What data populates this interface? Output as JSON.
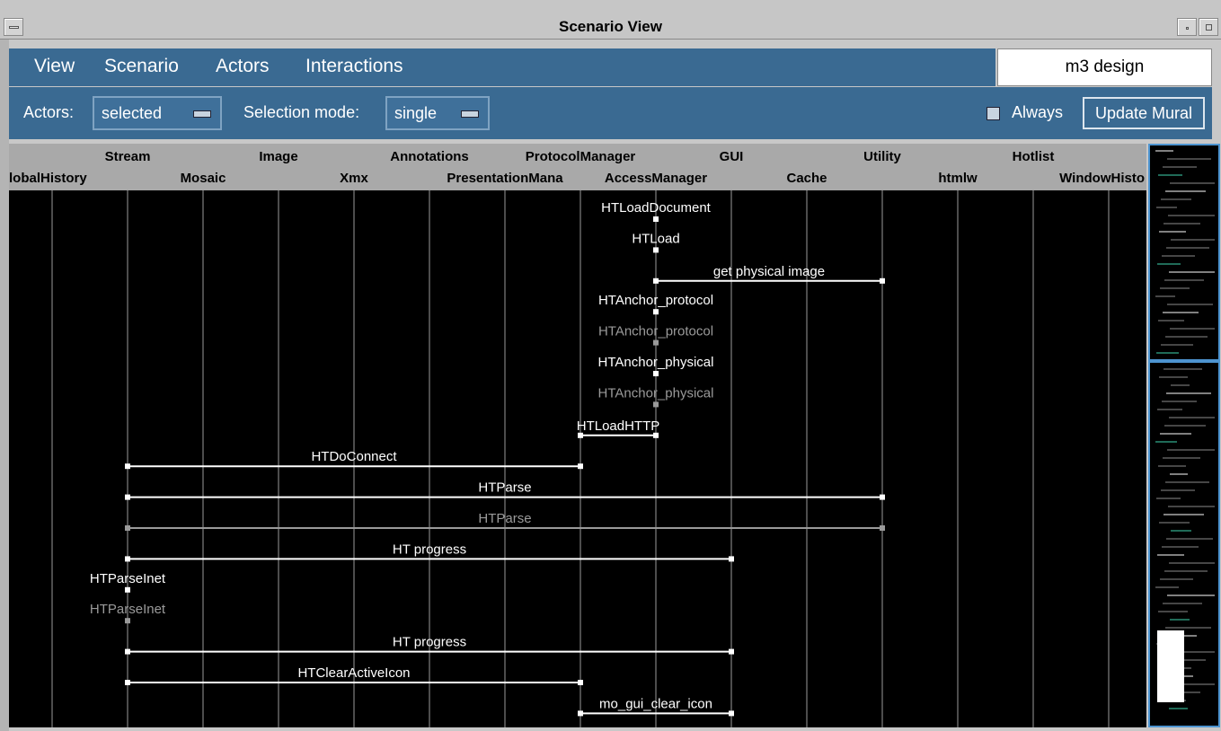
{
  "window": {
    "title": "Scenario View"
  },
  "menubar": {
    "items": [
      "View",
      "Scenario",
      "Actors",
      "Interactions"
    ]
  },
  "doc_name": "m3 design",
  "toolbar": {
    "actors_label": "Actors:",
    "actors_value": "selected",
    "mode_label": "Selection mode:",
    "mode_value": "single",
    "always_label": "Always",
    "update_label": "Update Mural"
  },
  "actors": {
    "row1": [
      "Stream",
      "Image",
      "Annotations",
      "ProtocolManager",
      "GUI",
      "Utility",
      "Hotlist"
    ],
    "row2": [
      "lobalHistory",
      "Mosaic",
      "Xmx",
      "PresentationMana",
      "AccessManager",
      "Cache",
      "htmlw",
      "WindowHisto"
    ]
  },
  "interactions": [
    {
      "label": "HTLoadDocument",
      "from": 8,
      "to": 8,
      "dim": false
    },
    {
      "label": "HTLoad",
      "from": 8,
      "to": 8,
      "dim": false
    },
    {
      "label": "get physical image",
      "from": 8,
      "to": 11,
      "dim": false
    },
    {
      "label": "HTAnchor_protocol",
      "from": 8,
      "to": 8,
      "dim": false
    },
    {
      "label": "HTAnchor_protocol",
      "from": 8,
      "to": 8,
      "dim": true
    },
    {
      "label": "HTAnchor_physical",
      "from": 8,
      "to": 8,
      "dim": false
    },
    {
      "label": "HTAnchor_physical",
      "from": 8,
      "to": 8,
      "dim": true
    },
    {
      "label": "HTLoadHTTP",
      "from": 8,
      "to": 7,
      "dim": false
    },
    {
      "label": "HTDoConnect",
      "from": 7,
      "to": 1,
      "dim": false
    },
    {
      "label": "HTParse",
      "from": 1,
      "to": 11,
      "dim": false
    },
    {
      "label": "HTParse",
      "from": 11,
      "to": 1,
      "dim": true
    },
    {
      "label": "HT progress",
      "from": 1,
      "to": 9,
      "dim": false
    },
    {
      "label": "HTParseInet",
      "from": 1,
      "to": 1,
      "dim": false
    },
    {
      "label": "HTParseInet",
      "from": 1,
      "to": 1,
      "dim": true
    },
    {
      "label": "HT progress",
      "from": 1,
      "to": 9,
      "dim": false
    },
    {
      "label": "HTClearActiveIcon",
      "from": 1,
      "to": 7,
      "dim": false
    },
    {
      "label": "mo_gui_clear_icon",
      "from": 7,
      "to": 9,
      "dim": false
    }
  ],
  "colors": {
    "panel": "#3a6a92",
    "diagram_bg": "#000000",
    "lifeline": "#9a9a9a",
    "dim": "#9a9a9a",
    "mural_border": "#4d94d0"
  }
}
